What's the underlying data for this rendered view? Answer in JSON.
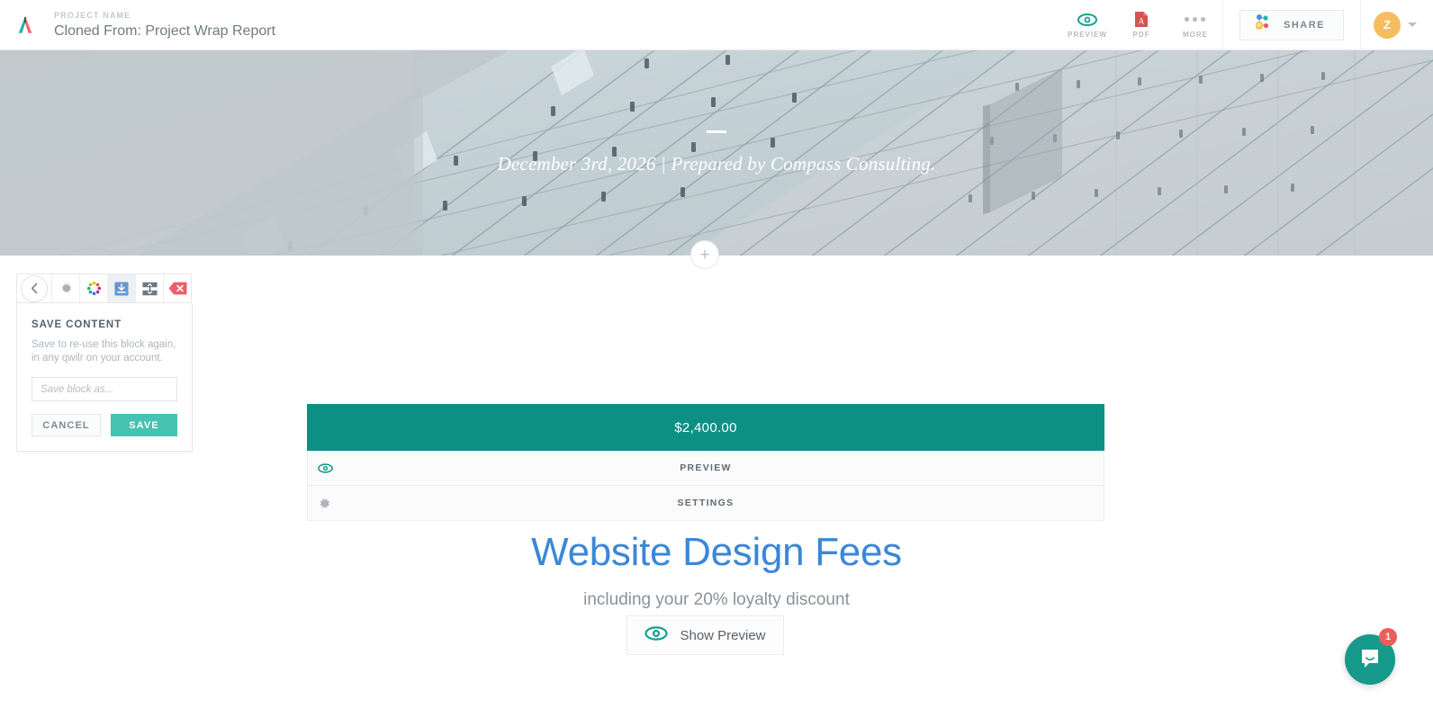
{
  "topbar": {
    "logo_icon": "qwilr-logo-icon",
    "project_label": "PROJECT NAME",
    "project_title": "Cloned From: Project Wrap Report",
    "tools": [
      {
        "icon": "eye-icon",
        "label": "PREVIEW"
      },
      {
        "icon": "pdf-icon",
        "label": "PDF"
      },
      {
        "icon": "ellipsis-icon",
        "label": "MORE"
      }
    ],
    "share": {
      "icon": "share-network-icon",
      "label": "SHARE"
    },
    "avatar": {
      "initial": "Z",
      "chevron_icon": "chevron-down-icon"
    }
  },
  "hero": {
    "divider": "",
    "subtitle": "December 3rd, 2026 | Prepared by Compass Consulting.",
    "background_image": "glass-building-facade-photo"
  },
  "add_block": {
    "icon": "plus-icon",
    "label": "+"
  },
  "block_toolbar": {
    "buttons": [
      {
        "name": "back-chevron-icon",
        "title": "Back"
      },
      {
        "name": "gear-icon",
        "title": "Settings"
      },
      {
        "name": "color-wheel-icon",
        "title": "Colors"
      },
      {
        "name": "save-download-icon",
        "title": "Save Content",
        "active": true
      },
      {
        "name": "move-resize-icon",
        "title": "Move"
      },
      {
        "name": "delete-x-icon",
        "title": "Delete"
      }
    ]
  },
  "save_panel": {
    "title": "SAVE CONTENT",
    "description": "Save to re-use this block again, in any qwilr on your account.",
    "input_value": "",
    "input_placeholder": "Save block as...",
    "cancel_label": "CANCEL",
    "save_label": "SAVE"
  },
  "price_block": {
    "amount": "$2,400.00",
    "options": [
      {
        "icon": "eye-icon",
        "label": "PREVIEW"
      },
      {
        "icon": "gear-icon",
        "label": "SETTINGS"
      }
    ]
  },
  "content": {
    "headline": "Website Design Fees",
    "subline": "including your 20% loyalty discount",
    "preview_button": {
      "icon": "eye-icon",
      "label": "Show Preview"
    }
  },
  "intercom": {
    "icon": "chat-bubble-icon",
    "badge_count": "1"
  },
  "colors": {
    "teal_price_bar": "#0d9084",
    "teal_accent": "#159a8c",
    "save_button": "#45c2b1",
    "headline_blue": "#3b87d8",
    "avatar_amber": "#f6bd5f",
    "badge_red": "#f15b5b",
    "delete_red": "#e4606a"
  }
}
